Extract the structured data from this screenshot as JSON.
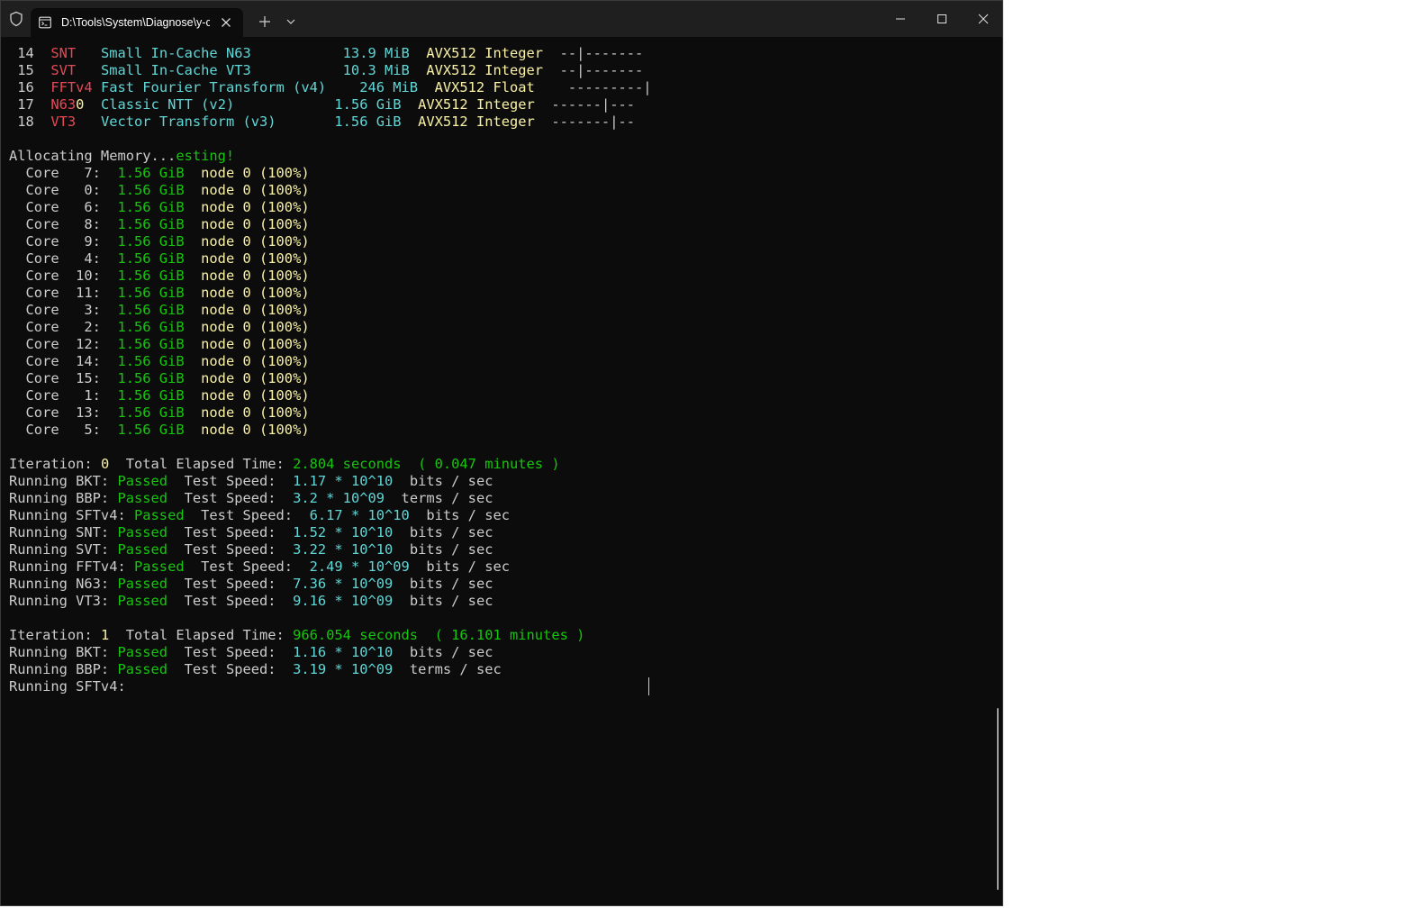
{
  "window": {
    "tab_title": "D:\\Tools\\System\\Diagnose\\y-cruncher",
    "icons": [
      "shield-icon",
      "terminal-icon",
      "close-icon",
      "plus-icon",
      "chevron-down-icon",
      "minimize-icon",
      "maximize-icon",
      "window-close-icon"
    ]
  },
  "colors": {
    "background": "#0c0c0c",
    "white": "#cccccc",
    "red": "#e74856",
    "cyan": "#61d6d6",
    "green": "#16c60c",
    "yellow": "#f9f1a5"
  },
  "terminal": {
    "lines": [
      [
        [
          "w",
          " 14  "
        ],
        [
          "r",
          "SNT   "
        ],
        [
          "c",
          "Small In-Cache N63           13.9 MiB  "
        ],
        [
          "y",
          "AVX512 Integer  "
        ],
        [
          "w",
          "--|-------"
        ]
      ],
      [
        [
          "w",
          " 15  "
        ],
        [
          "r",
          "SVT   "
        ],
        [
          "c",
          "Small In-Cache VT3           10.3 MiB  "
        ],
        [
          "y",
          "AVX512 Integer  "
        ],
        [
          "w",
          "--|-------"
        ]
      ],
      [
        [
          "w",
          " 16  "
        ],
        [
          "r",
          "FFTv4 "
        ],
        [
          "c",
          "Fast Fourier Transform (v4)    246 MiB  "
        ],
        [
          "y",
          "AVX512 Float    "
        ],
        [
          "w",
          "---------|"
        ]
      ],
      [
        [
          "w",
          " 17  "
        ],
        [
          "r",
          "N63"
        ],
        [
          "y",
          "0  "
        ],
        [
          "c",
          "Classic NTT (v2)            1.56 GiB  "
        ],
        [
          "y",
          "AVX512 Integer  "
        ],
        [
          "w",
          "------|---"
        ]
      ],
      [
        [
          "w",
          " 18  "
        ],
        [
          "r",
          "VT3   "
        ],
        [
          "c",
          "Vector Transform (v3)       1.56 GiB  "
        ],
        [
          "y",
          "AVX512 Integer  "
        ],
        [
          "w",
          "-------|--"
        ]
      ],
      [],
      [
        [
          "w",
          "Allocating Memory..."
        ],
        [
          "g",
          "esting!"
        ]
      ],
      [
        [
          "w",
          "  Core   7:  "
        ],
        [
          "g",
          "1.56 GiB  "
        ],
        [
          "y",
          "node 0 (100%)"
        ]
      ],
      [
        [
          "w",
          "  Core   0:  "
        ],
        [
          "g",
          "1.56 GiB  "
        ],
        [
          "y",
          "node 0 (100%)"
        ]
      ],
      [
        [
          "w",
          "  Core   6:  "
        ],
        [
          "g",
          "1.56 GiB  "
        ],
        [
          "y",
          "node 0 (100%)"
        ]
      ],
      [
        [
          "w",
          "  Core   8:  "
        ],
        [
          "g",
          "1.56 GiB  "
        ],
        [
          "y",
          "node 0 (100%)"
        ]
      ],
      [
        [
          "w",
          "  Core   9:  "
        ],
        [
          "g",
          "1.56 GiB  "
        ],
        [
          "y",
          "node 0 (100%)"
        ]
      ],
      [
        [
          "w",
          "  Core   4:  "
        ],
        [
          "g",
          "1.56 GiB  "
        ],
        [
          "y",
          "node 0 (100%)"
        ]
      ],
      [
        [
          "w",
          "  Core  10:  "
        ],
        [
          "g",
          "1.56 GiB  "
        ],
        [
          "y",
          "node 0 (100%)"
        ]
      ],
      [
        [
          "w",
          "  Core  11:  "
        ],
        [
          "g",
          "1.56 GiB  "
        ],
        [
          "y",
          "node 0 (100%)"
        ]
      ],
      [
        [
          "w",
          "  Core   3:  "
        ],
        [
          "g",
          "1.56 GiB  "
        ],
        [
          "y",
          "node 0 (100%)"
        ]
      ],
      [
        [
          "w",
          "  Core   2:  "
        ],
        [
          "g",
          "1.56 GiB  "
        ],
        [
          "y",
          "node 0 (100%)"
        ]
      ],
      [
        [
          "w",
          "  Core  12:  "
        ],
        [
          "g",
          "1.56 GiB  "
        ],
        [
          "y",
          "node 0 (100%)"
        ]
      ],
      [
        [
          "w",
          "  Core  14:  "
        ],
        [
          "g",
          "1.56 GiB  "
        ],
        [
          "y",
          "node 0 (100%)"
        ]
      ],
      [
        [
          "w",
          "  Core  15:  "
        ],
        [
          "g",
          "1.56 GiB  "
        ],
        [
          "y",
          "node 0 (100%)"
        ]
      ],
      [
        [
          "w",
          "  Core   1:  "
        ],
        [
          "g",
          "1.56 GiB  "
        ],
        [
          "y",
          "node 0 (100%)"
        ]
      ],
      [
        [
          "w",
          "  Core  13:  "
        ],
        [
          "g",
          "1.56 GiB  "
        ],
        [
          "y",
          "node 0 (100%)"
        ]
      ],
      [
        [
          "w",
          "  Core   5:  "
        ],
        [
          "g",
          "1.56 GiB  "
        ],
        [
          "y",
          "node 0 (100%)"
        ]
      ],
      [],
      [
        [
          "w",
          "Iteration: "
        ],
        [
          "y",
          "0"
        ],
        [
          "w",
          "  Total Elapsed Time: "
        ],
        [
          "g",
          "2.804 seconds  ( 0.047 minutes )"
        ]
      ],
      [
        [
          "w",
          "Running BKT: "
        ],
        [
          "g",
          "Passed"
        ],
        [
          "w",
          "  Test Speed:  "
        ],
        [
          "c",
          "1.17 * 10^10"
        ],
        [
          "w",
          "  bits / sec"
        ]
      ],
      [
        [
          "w",
          "Running BBP: "
        ],
        [
          "g",
          "Passed"
        ],
        [
          "w",
          "  Test Speed:  "
        ],
        [
          "c",
          "3.2 * 10^09"
        ],
        [
          "w",
          "  terms / sec"
        ]
      ],
      [
        [
          "w",
          "Running SFTv4: "
        ],
        [
          "g",
          "Passed"
        ],
        [
          "w",
          "  Test Speed:  "
        ],
        [
          "c",
          "6.17 * 10^10"
        ],
        [
          "w",
          "  bits / sec"
        ]
      ],
      [
        [
          "w",
          "Running SNT: "
        ],
        [
          "g",
          "Passed"
        ],
        [
          "w",
          "  Test Speed:  "
        ],
        [
          "c",
          "1.52 * 10^10"
        ],
        [
          "w",
          "  bits / sec"
        ]
      ],
      [
        [
          "w",
          "Running SVT: "
        ],
        [
          "g",
          "Passed"
        ],
        [
          "w",
          "  Test Speed:  "
        ],
        [
          "c",
          "3.22 * 10^10"
        ],
        [
          "w",
          "  bits / sec"
        ]
      ],
      [
        [
          "w",
          "Running FFTv4: "
        ],
        [
          "g",
          "Passed"
        ],
        [
          "w",
          "  Test Speed:  "
        ],
        [
          "c",
          "2.49 * 10^09"
        ],
        [
          "w",
          "  bits / sec"
        ]
      ],
      [
        [
          "w",
          "Running N63: "
        ],
        [
          "g",
          "Passed"
        ],
        [
          "w",
          "  Test Speed:  "
        ],
        [
          "c",
          "7.36 * 10^09"
        ],
        [
          "w",
          "  bits / sec"
        ]
      ],
      [
        [
          "w",
          "Running VT3: "
        ],
        [
          "g",
          "Passed"
        ],
        [
          "w",
          "  Test Speed:  "
        ],
        [
          "c",
          "9.16 * 10^09"
        ],
        [
          "w",
          "  bits / sec"
        ]
      ],
      [],
      [
        [
          "w",
          "Iteration: "
        ],
        [
          "y",
          "1"
        ],
        [
          "w",
          "  Total Elapsed Time: "
        ],
        [
          "g",
          "966.054 seconds  ( 16.101 minutes )"
        ]
      ],
      [
        [
          "w",
          "Running BKT: "
        ],
        [
          "g",
          "Passed"
        ],
        [
          "w",
          "  Test Speed:  "
        ],
        [
          "c",
          "1.16 * 10^10"
        ],
        [
          "w",
          "  bits / sec"
        ]
      ],
      [
        [
          "w",
          "Running BBP: "
        ],
        [
          "g",
          "Passed"
        ],
        [
          "w",
          "  Test Speed:  "
        ],
        [
          "c",
          "3.19 * 10^09"
        ],
        [
          "w",
          "  terms / sec"
        ]
      ],
      [
        [
          "w",
          "Running SFTv4:"
        ]
      ]
    ]
  }
}
